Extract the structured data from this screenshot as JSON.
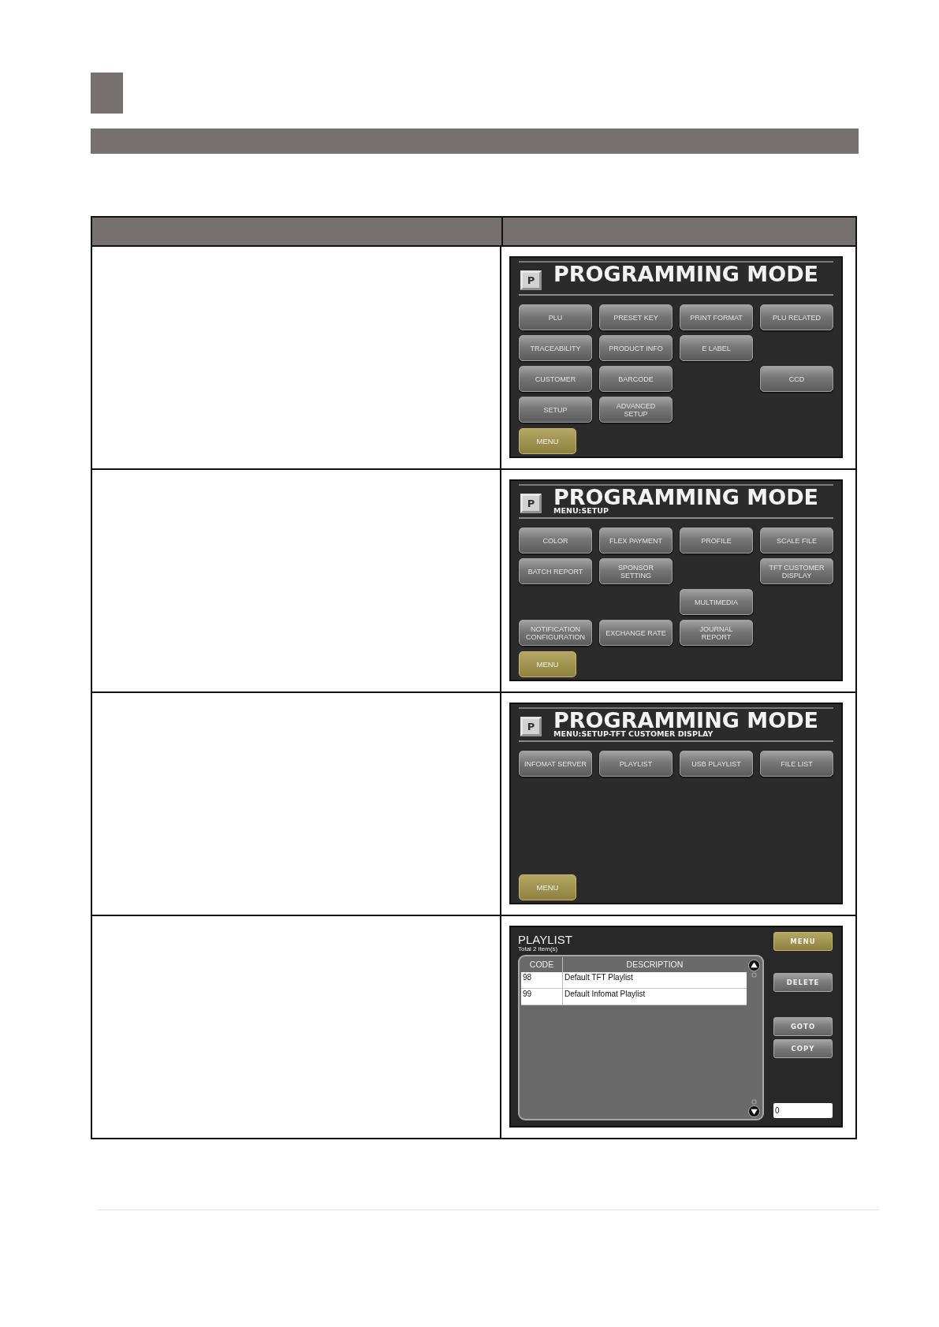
{
  "table": {
    "rows": [
      {
        "screen": {
          "kind": "menu",
          "badge": "P",
          "title": "PROGRAMMING MODE",
          "grid": [
            [
              {
                "kind": "button",
                "label": "PLU"
              },
              {
                "kind": "button",
                "label": "PRESET KEY"
              },
              {
                "kind": "button",
                "label": "PRINT FORMAT"
              },
              {
                "kind": "button",
                "label": "PLU RELATED"
              }
            ],
            [
              {
                "kind": "button",
                "label": "TRACEABILITY"
              },
              {
                "kind": "button",
                "label": "PRODUCT INFO"
              },
              {
                "kind": "button",
                "label": "E LABEL"
              }
            ],
            [
              {
                "kind": "button",
                "label": "CUSTOMER"
              },
              {
                "kind": "button",
                "label": "BARCODE"
              },
              {
                "kind": "blank"
              },
              {
                "kind": "button",
                "label": "CCD"
              }
            ],
            [
              {
                "kind": "button",
                "label": "SETUP"
              },
              {
                "kind": "button",
                "label": "ADVANCED\nSETUP"
              }
            ]
          ],
          "menu_button": "MENU"
        }
      },
      {
        "screen": {
          "kind": "menu",
          "badge": "P",
          "title": "PROGRAMMING MODE",
          "breadcrumb": "MENU:SETUP",
          "grid": [
            [
              {
                "kind": "button",
                "label": "COLOR"
              },
              {
                "kind": "button",
                "label": "FLEX PAYMENT"
              },
              {
                "kind": "button",
                "label": "PROFILE"
              },
              {
                "kind": "button",
                "label": "SCALE FILE"
              }
            ],
            [
              {
                "kind": "button",
                "label": "BATCH REPORT"
              },
              {
                "kind": "button",
                "label": "SPONSOR\nSETTING"
              },
              {
                "kind": "blank"
              },
              {
                "kind": "button",
                "label": "TFT CUSTOMER\nDISPLAY"
              }
            ],
            [
              {
                "kind": "blank"
              },
              {
                "kind": "blank"
              },
              {
                "kind": "button",
                "label": "MULTIMEDIA"
              }
            ],
            [
              {
                "kind": "button",
                "label": "NOTIFICATION\nCONFIGURATION"
              },
              {
                "kind": "button",
                "label": "EXCHANGE RATE"
              },
              {
                "kind": "button",
                "label": "JOURNAL\nREPORT"
              }
            ]
          ],
          "menu_button": "MENU"
        }
      },
      {
        "screen": {
          "kind": "menu",
          "badge": "P",
          "title": "PROGRAMMING MODE",
          "breadcrumb": "MENU:SETUP-TFT CUSTOMER DISPLAY",
          "grid": [
            [
              {
                "kind": "button",
                "label": "INFOMAT SERVER"
              },
              {
                "kind": "button",
                "label": "PLAYLIST"
              },
              {
                "kind": "button",
                "label": "USB PLAYLIST"
              },
              {
                "kind": "button",
                "label": "FILE LIST"
              }
            ]
          ],
          "menu_button": "MENU"
        }
      },
      {
        "screen": {
          "kind": "list",
          "title": "PLAYLIST",
          "subtitle": "Total 2 item(s)",
          "columns": [
            "CODE",
            "DESCRIPTION"
          ],
          "rows": [
            [
              "98",
              "Default TFT Playlist"
            ],
            [
              "99",
              "Default Infomat Playlist"
            ]
          ],
          "buttons": [
            {
              "kind": "menu",
              "label": "MENU"
            },
            {
              "kind": "action",
              "label": "DELETE"
            },
            {
              "kind": "action",
              "label": "GOTO"
            },
            {
              "kind": "action",
              "label": "COPY"
            }
          ],
          "input": {
            "value": "0"
          }
        }
      }
    ]
  }
}
